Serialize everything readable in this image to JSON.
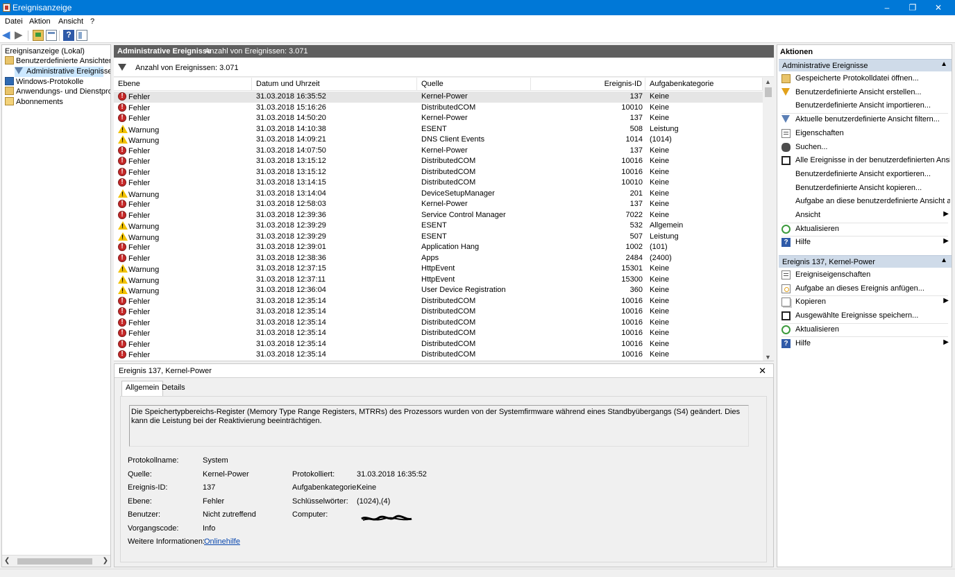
{
  "window": {
    "title": "Ereignisanzeige",
    "minimize": "–",
    "maximize": "❐",
    "close": "✕"
  },
  "menu": [
    "Datei",
    "Aktion",
    "Ansicht",
    "?"
  ],
  "toolbar": {
    "icons": [
      "back-arrow-icon",
      "forward-arrow-icon",
      "up-folder-icon",
      "properties-icon",
      "help-icon",
      "show-hide-icon"
    ]
  },
  "tree": {
    "root": "Ereignisanzeige (Lokal)",
    "custom_views": "Benutzerdefinierte Ansichten",
    "admin_events": "Administrative Ereignisse",
    "windows_logs": "Windows-Protokolle",
    "app_logs": "Anwendungs- und Dienstproto",
    "subscriptions": "Abonnements"
  },
  "main": {
    "header_title": "Administrative Ereignisse",
    "header_count": "Anzahl von Ereignissen: 3.071",
    "filter_text": "Anzahl von Ereignissen: 3.071",
    "columns": {
      "level": "Ebene",
      "date": "Datum und Uhrzeit",
      "source": "Quelle",
      "event_id": "Ereignis-ID",
      "category": "Aufgabenkategorie"
    },
    "rows": [
      {
        "level": "Fehler",
        "type": "error",
        "date": "31.03.2018 16:35:52",
        "source": "Kernel-Power",
        "id": "137",
        "category": "Keine"
      },
      {
        "level": "Fehler",
        "type": "error",
        "date": "31.03.2018 15:16:26",
        "source": "DistributedCOM",
        "id": "10010",
        "category": "Keine"
      },
      {
        "level": "Fehler",
        "type": "error",
        "date": "31.03.2018 14:50:20",
        "source": "Kernel-Power",
        "id": "137",
        "category": "Keine"
      },
      {
        "level": "Warnung",
        "type": "warning",
        "date": "31.03.2018 14:10:38",
        "source": "ESENT",
        "id": "508",
        "category": "Leistung"
      },
      {
        "level": "Warnung",
        "type": "warning",
        "date": "31.03.2018 14:09:21",
        "source": "DNS Client Events",
        "id": "1014",
        "category": "(1014)"
      },
      {
        "level": "Fehler",
        "type": "error",
        "date": "31.03.2018 14:07:50",
        "source": "Kernel-Power",
        "id": "137",
        "category": "Keine"
      },
      {
        "level": "Fehler",
        "type": "error",
        "date": "31.03.2018 13:15:12",
        "source": "DistributedCOM",
        "id": "10016",
        "category": "Keine"
      },
      {
        "level": "Fehler",
        "type": "error",
        "date": "31.03.2018 13:15:12",
        "source": "DistributedCOM",
        "id": "10016",
        "category": "Keine"
      },
      {
        "level": "Fehler",
        "type": "error",
        "date": "31.03.2018 13:14:15",
        "source": "DistributedCOM",
        "id": "10010",
        "category": "Keine"
      },
      {
        "level": "Warnung",
        "type": "warning",
        "date": "31.03.2018 13:14:04",
        "source": "DeviceSetupManager",
        "id": "201",
        "category": "Keine"
      },
      {
        "level": "Fehler",
        "type": "error",
        "date": "31.03.2018 12:58:03",
        "source": "Kernel-Power",
        "id": "137",
        "category": "Keine"
      },
      {
        "level": "Fehler",
        "type": "error",
        "date": "31.03.2018 12:39:36",
        "source": "Service Control Manager",
        "id": "7022",
        "category": "Keine"
      },
      {
        "level": "Warnung",
        "type": "warning",
        "date": "31.03.2018 12:39:29",
        "source": "ESENT",
        "id": "532",
        "category": "Allgemein"
      },
      {
        "level": "Warnung",
        "type": "warning",
        "date": "31.03.2018 12:39:29",
        "source": "ESENT",
        "id": "507",
        "category": "Leistung"
      },
      {
        "level": "Fehler",
        "type": "error",
        "date": "31.03.2018 12:39:01",
        "source": "Application Hang",
        "id": "1002",
        "category": "(101)"
      },
      {
        "level": "Fehler",
        "type": "error",
        "date": "31.03.2018 12:38:36",
        "source": "Apps",
        "id": "2484",
        "category": "(2400)"
      },
      {
        "level": "Warnung",
        "type": "warning",
        "date": "31.03.2018 12:37:15",
        "source": "HttpEvent",
        "id": "15301",
        "category": "Keine"
      },
      {
        "level": "Warnung",
        "type": "warning",
        "date": "31.03.2018 12:37:11",
        "source": "HttpEvent",
        "id": "15300",
        "category": "Keine"
      },
      {
        "level": "Warnung",
        "type": "warning",
        "date": "31.03.2018 12:36:04",
        "source": "User Device Registration",
        "id": "360",
        "category": "Keine"
      },
      {
        "level": "Fehler",
        "type": "error",
        "date": "31.03.2018 12:35:14",
        "source": "DistributedCOM",
        "id": "10016",
        "category": "Keine"
      },
      {
        "level": "Fehler",
        "type": "error",
        "date": "31.03.2018 12:35:14",
        "source": "DistributedCOM",
        "id": "10016",
        "category": "Keine"
      },
      {
        "level": "Fehler",
        "type": "error",
        "date": "31.03.2018 12:35:14",
        "source": "DistributedCOM",
        "id": "10016",
        "category": "Keine"
      },
      {
        "level": "Fehler",
        "type": "error",
        "date": "31.03.2018 12:35:14",
        "source": "DistributedCOM",
        "id": "10016",
        "category": "Keine"
      },
      {
        "level": "Fehler",
        "type": "error",
        "date": "31.03.2018 12:35:14",
        "source": "DistributedCOM",
        "id": "10016",
        "category": "Keine"
      },
      {
        "level": "Fehler",
        "type": "error",
        "date": "31.03.2018 12:35:14",
        "source": "DistributedCOM",
        "id": "10016",
        "category": "Keine"
      }
    ]
  },
  "detail": {
    "title": "Ereignis 137, Kernel-Power",
    "close": "✕",
    "tabs": [
      "Allgemein",
      "Details"
    ],
    "description": "Die Speichertypbereichs-Register (Memory Type Range Registers, MTRRs) des Prozessors wurden von der Systemfirmware während eines Standbyübergangs (S4) geändert. Dies kann die Leistung bei der Reaktivierung beeinträchtigen.",
    "labels": {
      "log_name": "Protokollname:",
      "source": "Quelle:",
      "event_id": "Ereignis-ID:",
      "level": "Ebene:",
      "user": "Benutzer:",
      "opcode": "Vorgangscode:",
      "more_info": "Weitere Informationen:",
      "logged": "Protokolliert:",
      "task_category": "Aufgabenkategorie:",
      "keywords": "Schlüsselwörter:",
      "computer": "Computer:"
    },
    "values": {
      "log_name": "System",
      "source": "Kernel-Power",
      "event_id": "137",
      "level": "Fehler",
      "user": "Nicht zutreffend",
      "opcode": "Info",
      "more_info": "Onlinehilfe",
      "logged": "31.03.2018 16:35:52",
      "task_category": "Keine",
      "keywords": "(1024),(4)"
    }
  },
  "actions": {
    "title": "Aktionen",
    "section1": "Administrative Ereignisse",
    "items1": [
      {
        "label": "Gespeicherte Protokolldatei öffnen...",
        "icon": "folder-open-icon"
      },
      {
        "label": "Benutzerdefinierte Ansicht erstellen...",
        "icon": "create-view-filter-icon"
      },
      {
        "label": "Benutzerdefinierte Ansicht importieren...",
        "icon": ""
      },
      {
        "label": "Aktuelle benutzerdefinierte Ansicht filtern...",
        "icon": "filter-icon"
      },
      {
        "label": "Eigenschaften",
        "icon": "properties-icon"
      },
      {
        "label": "Suchen...",
        "icon": "binoculars-icon"
      },
      {
        "label": "Alle Ereignisse in der benutzerdefinierten Ansi...",
        "icon": "save-icon"
      },
      {
        "label": "Benutzerdefinierte Ansicht exportieren...",
        "icon": ""
      },
      {
        "label": "Benutzerdefinierte Ansicht kopieren...",
        "icon": ""
      },
      {
        "label": "Aufgabe an diese benutzerdefinierte Ansicht a...",
        "icon": ""
      },
      {
        "label": "Ansicht",
        "icon": "",
        "submenu": "▶"
      },
      {
        "label": "Aktualisieren",
        "icon": "refresh-icon"
      },
      {
        "label": "Hilfe",
        "icon": "help-icon",
        "submenu": "▶"
      }
    ],
    "section2": "Ereignis 137, Kernel-Power",
    "items2": [
      {
        "label": "Ereigniseigenschaften",
        "icon": "properties-icon"
      },
      {
        "label": "Aufgabe an dieses Ereignis anfügen...",
        "icon": "attach-task-icon"
      },
      {
        "label": "Kopieren",
        "icon": "copy-icon",
        "submenu": "▶"
      },
      {
        "label": "Ausgewählte Ereignisse speichern...",
        "icon": "save-icon"
      },
      {
        "label": "Aktualisieren",
        "icon": "refresh-icon"
      },
      {
        "label": "Hilfe",
        "icon": "help-icon",
        "submenu": "▶"
      }
    ],
    "collapse": "▲"
  },
  "colors": {
    "titlebar": "#0078d7",
    "section_header": "#cfdbe9",
    "pane_header": "#5f5f5f",
    "error": "#c62828",
    "warning": "#f2c200"
  }
}
